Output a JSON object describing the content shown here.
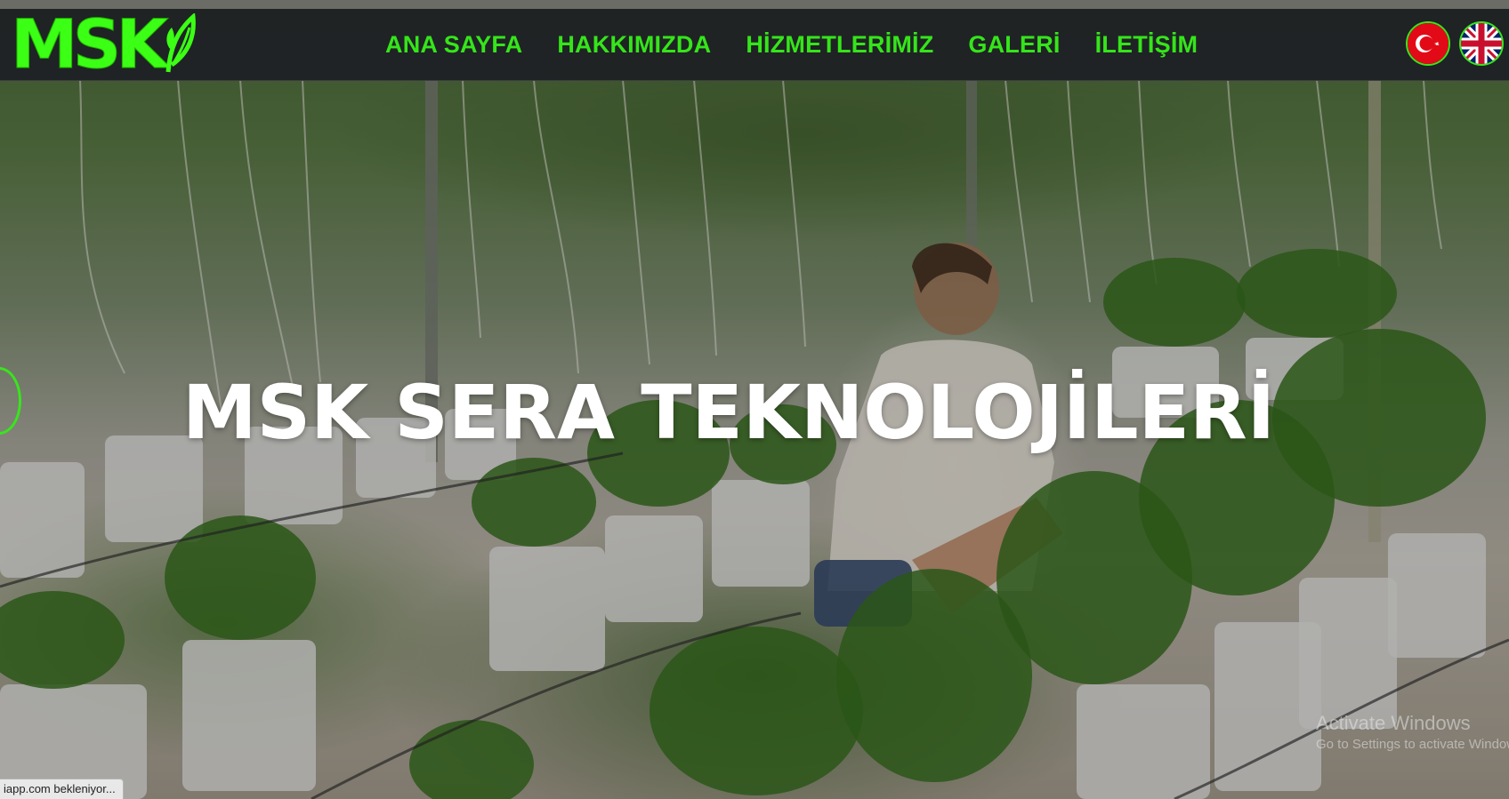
{
  "logo": {
    "text": "MSK",
    "icon": "leaf-icon"
  },
  "nav": {
    "items": [
      {
        "label": "ANA SAYFA"
      },
      {
        "label": "HAKKIMIZDA"
      },
      {
        "label": "HİZMETLERİMİZ"
      },
      {
        "label": "GALERİ"
      },
      {
        "label": "İLETİŞİM"
      }
    ]
  },
  "languages": [
    {
      "icon": "turkey-flag-icon"
    },
    {
      "icon": "uk-flag-icon"
    }
  ],
  "hero": {
    "title": "MSK SERA TEKNOLOJİLERİ"
  },
  "slider": {
    "prev_icon": "slider-prev-icon"
  },
  "status_bar": {
    "text": "iapp.com bekleniyor..."
  },
  "watermark": {
    "title": "Activate Windows",
    "subtitle": "Go to Settings to activate Windows."
  },
  "colors": {
    "accent": "#35e51a",
    "navbar_bg": "#1e2124",
    "title": "#ffffff"
  }
}
